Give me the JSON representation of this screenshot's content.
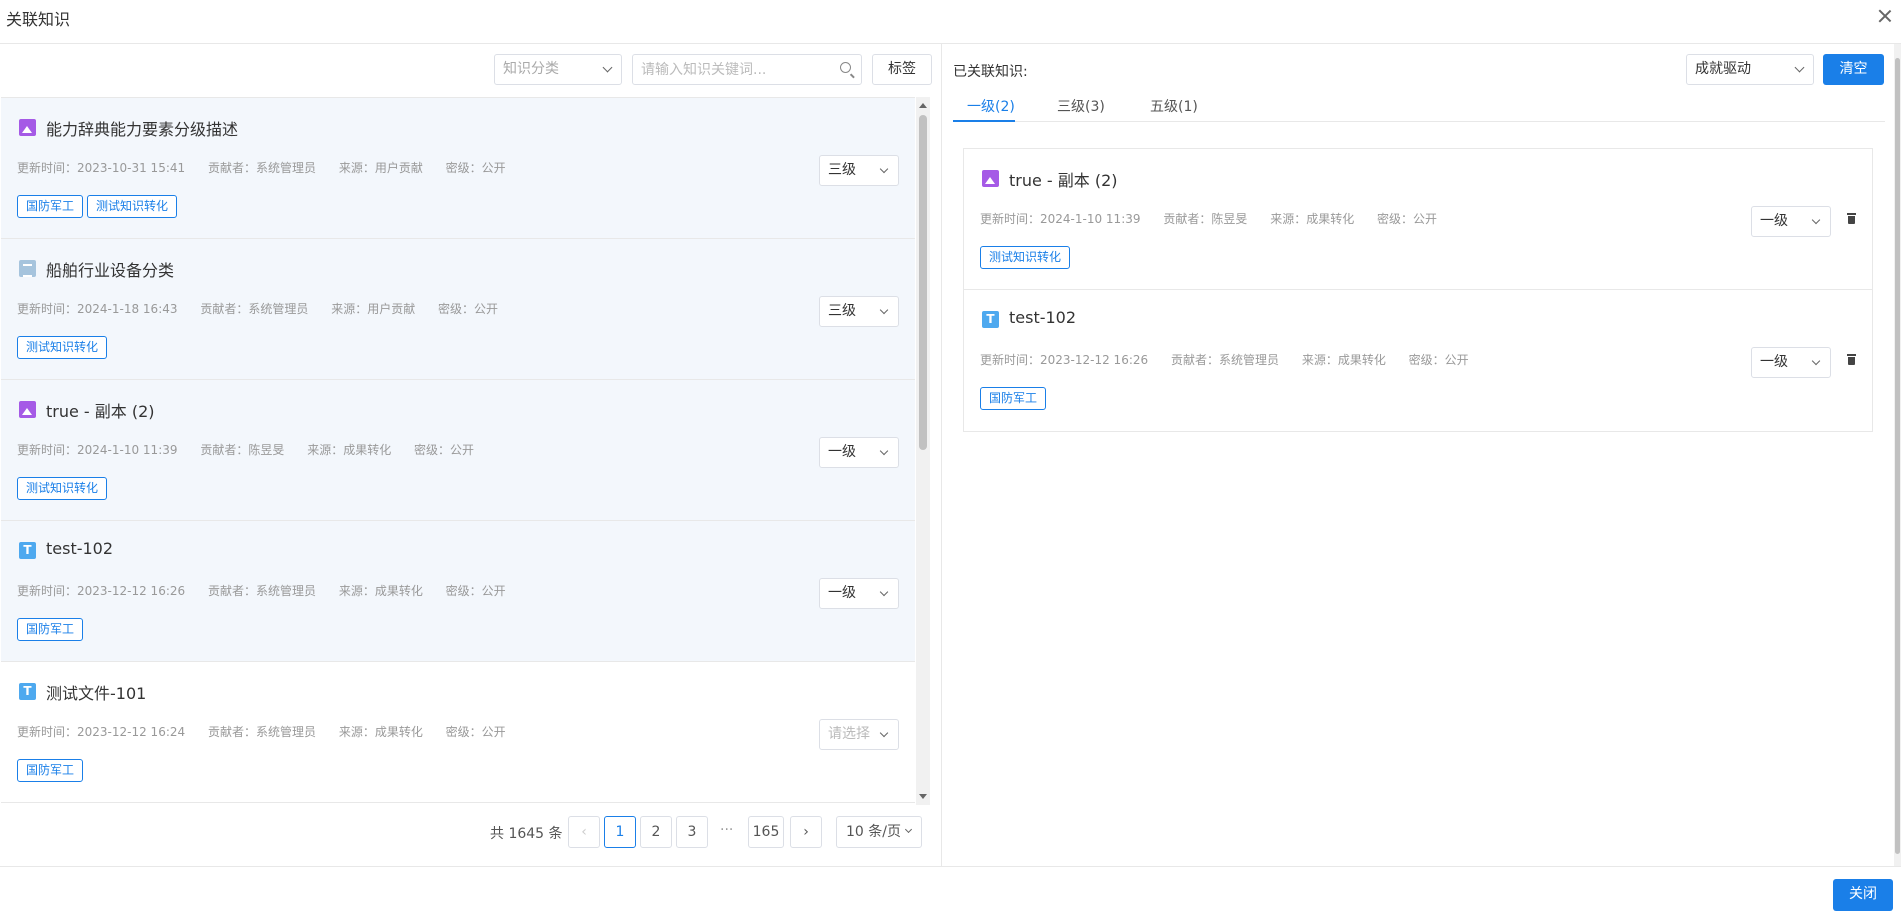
{
  "dialog": {
    "title": "关联知识",
    "close_label": "关闭"
  },
  "filters": {
    "category_placeholder": "知识分类",
    "search_placeholder": "请输入知识关键词...",
    "tag_button": "标签"
  },
  "list": {
    "items": [
      {
        "title": "能力辞典能力要素分级描述",
        "icon": "image-icon",
        "updated": "更新时间：2023-10-31 15:41",
        "contributor": "贡献者：系统管理员",
        "source": "来源：用户贡献",
        "secret": "密级：公开",
        "tags": [
          "国防军工",
          "测试知识转化"
        ],
        "level": "三级"
      },
      {
        "title": "船舶行业设备分类",
        "icon": "document-icon",
        "updated": "更新时间：2024-1-18 16:43",
        "contributor": "贡献者：系统管理员",
        "source": "来源：用户贡献",
        "secret": "密级：公开",
        "tags": [
          "测试知识转化"
        ],
        "level": "三级"
      },
      {
        "title": "true - 副本 (2)",
        "icon": "image-icon",
        "updated": "更新时间：2024-1-10 11:39",
        "contributor": "贡献者：陈昱旻",
        "source": "来源：成果转化",
        "secret": "密级：公开",
        "tags": [
          "测试知识转化"
        ],
        "level": "一级"
      },
      {
        "title": "test-102",
        "icon": "text-icon",
        "updated": "更新时间：2023-12-12 16:26",
        "contributor": "贡献者：系统管理员",
        "source": "来源：成果转化",
        "secret": "密级：公开",
        "tags": [
          "国防军工"
        ],
        "level": "一级"
      },
      {
        "title": "测试文件-101",
        "icon": "text-icon",
        "updated": "更新时间：2023-12-12 16:24",
        "contributor": "贡献者：系统管理员",
        "source": "来源：成果转化",
        "secret": "密级：公开",
        "tags": [
          "国防军工"
        ],
        "level": "请选择"
      }
    ]
  },
  "pagination": {
    "total": "共 1645 条",
    "pages": [
      "1",
      "2",
      "3",
      "···",
      "165"
    ],
    "current": "1",
    "page_size": "10 条/页"
  },
  "right": {
    "label": "已关联知识:",
    "drive_select": "成就驱动",
    "clear_button": "清空",
    "tabs": [
      "一级(2)",
      "三级(3)",
      "五级(1)"
    ],
    "active_tab": "一级(2)",
    "items": [
      {
        "title": "true - 副本 (2)",
        "icon": "image-icon",
        "updated": "更新时间：2024-1-10 11:39",
        "contributor": "贡献者：陈昱旻",
        "source": "来源：成果转化",
        "secret": "密级：公开",
        "tags": [
          "测试知识转化"
        ],
        "level": "一级"
      },
      {
        "title": "test-102",
        "icon": "text-icon",
        "updated": "更新时间：2023-12-12 16:26",
        "contributor": "贡献者：系统管理员",
        "source": "来源：成果转化",
        "secret": "密级：公开",
        "tags": [
          "国防军工"
        ],
        "level": "一级"
      }
    ]
  },
  "icons": {
    "text_glyph": "T"
  },
  "colors": {
    "primary": "#1a7fe8",
    "image_icon": "#a55ae6",
    "text_icon": "#4ea9ef",
    "doc_icon": "#a6c4dd"
  }
}
